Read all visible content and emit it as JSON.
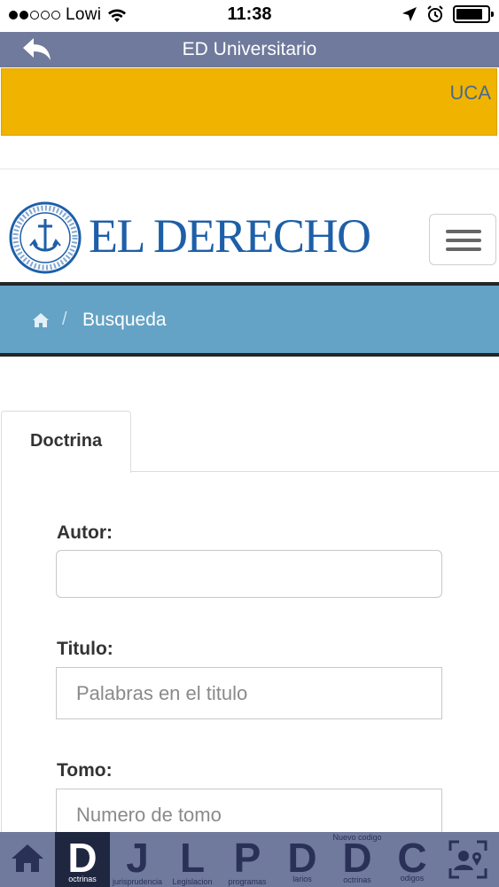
{
  "status_bar": {
    "carrier": "Lowi",
    "time": "11:38",
    "battery_level": 0.85
  },
  "header": {
    "title": "ED Universitario",
    "back_icon": "back-arrow-icon"
  },
  "banner": {
    "link_label": "UCA"
  },
  "brand": {
    "name": "EL DERECHO",
    "menu_icon": "hamburger-menu-icon"
  },
  "breadcrumb": {
    "home_icon": "home-icon",
    "separator": "/",
    "current": "Busqueda"
  },
  "tabs": [
    {
      "label": "Doctrina",
      "active": true
    }
  ],
  "form": {
    "autor": {
      "label": "Autor:",
      "value": "",
      "placeholder": ""
    },
    "titulo": {
      "label": "Titulo:",
      "value": "",
      "placeholder": "Palabras en el titulo"
    },
    "tomo": {
      "label": "Tomo:",
      "value": "",
      "placeholder": "Numero de tomo"
    }
  },
  "bottom_nav": {
    "items": [
      {
        "icon": "home-icon",
        "letter": "",
        "label": ""
      },
      {
        "letter": "D",
        "label": "octrinas",
        "active": true
      },
      {
        "letter": "J",
        "label": "jurisprudencia"
      },
      {
        "letter": "L",
        "label": "Legislacion"
      },
      {
        "letter": "P",
        "label": "programas"
      },
      {
        "letter": "D",
        "label": "larios"
      },
      {
        "letter": "D",
        "label": "octrinas",
        "top_label": "Nuevo codigo"
      },
      {
        "letter": "C",
        "label": "odigos"
      },
      {
        "icon": "profile-location-icon",
        "letter": "",
        "label": ""
      }
    ]
  },
  "colors": {
    "header_bg": "#6f7a9c",
    "banner_bg": "#f0b400",
    "breadcrumb_bg": "#64a3c5",
    "brand_blue": "#1d5fa8",
    "nav_active_bg": "#1f2640"
  }
}
